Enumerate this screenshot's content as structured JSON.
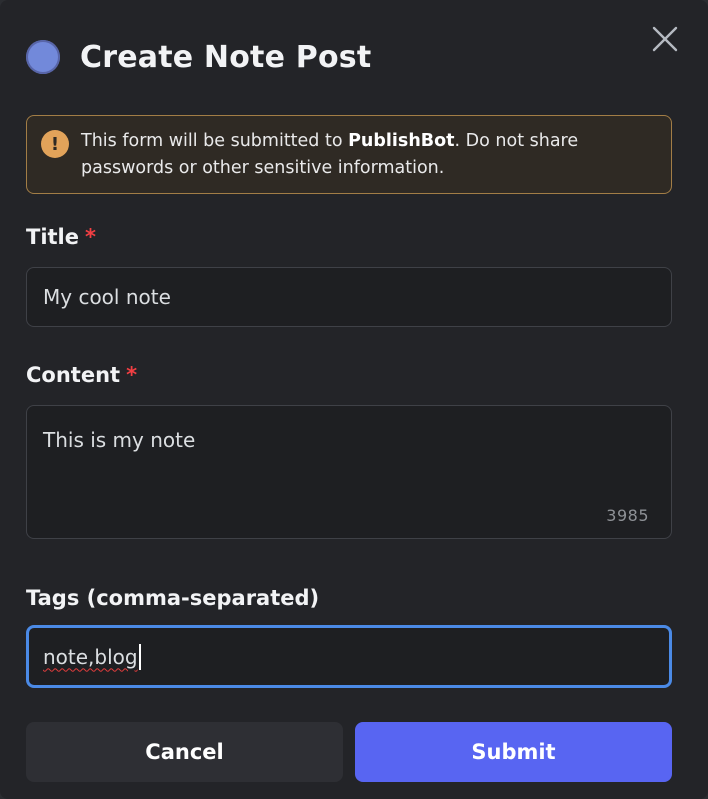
{
  "modal": {
    "title": "Create Note Post",
    "close_label": "×"
  },
  "warning": {
    "icon_glyph": "!",
    "text_before": "This form will be submitted to ",
    "bot_name": "PublishBot",
    "text_after": ". Do not share passwords or other sensitive information."
  },
  "fields": {
    "title": {
      "label": "Title",
      "required_mark": "*",
      "value": "My cool note"
    },
    "content": {
      "label": "Content",
      "required_mark": "*",
      "value": "This is my note",
      "remaining_count": "3985"
    },
    "tags": {
      "label": "Tags (comma-separated)",
      "value": "note,blog"
    }
  },
  "actions": {
    "cancel_label": "Cancel",
    "submit_label": "Submit"
  },
  "colors": {
    "accent": "#5865f2",
    "focus_border": "#4b8ae6",
    "warning_border": "#a27d46",
    "warning_icon": "#e2a35a",
    "required": "#f23f43"
  },
  "icons": {
    "bot_avatar": "bot-avatar",
    "close": "close-icon",
    "warning": "warning-icon"
  }
}
